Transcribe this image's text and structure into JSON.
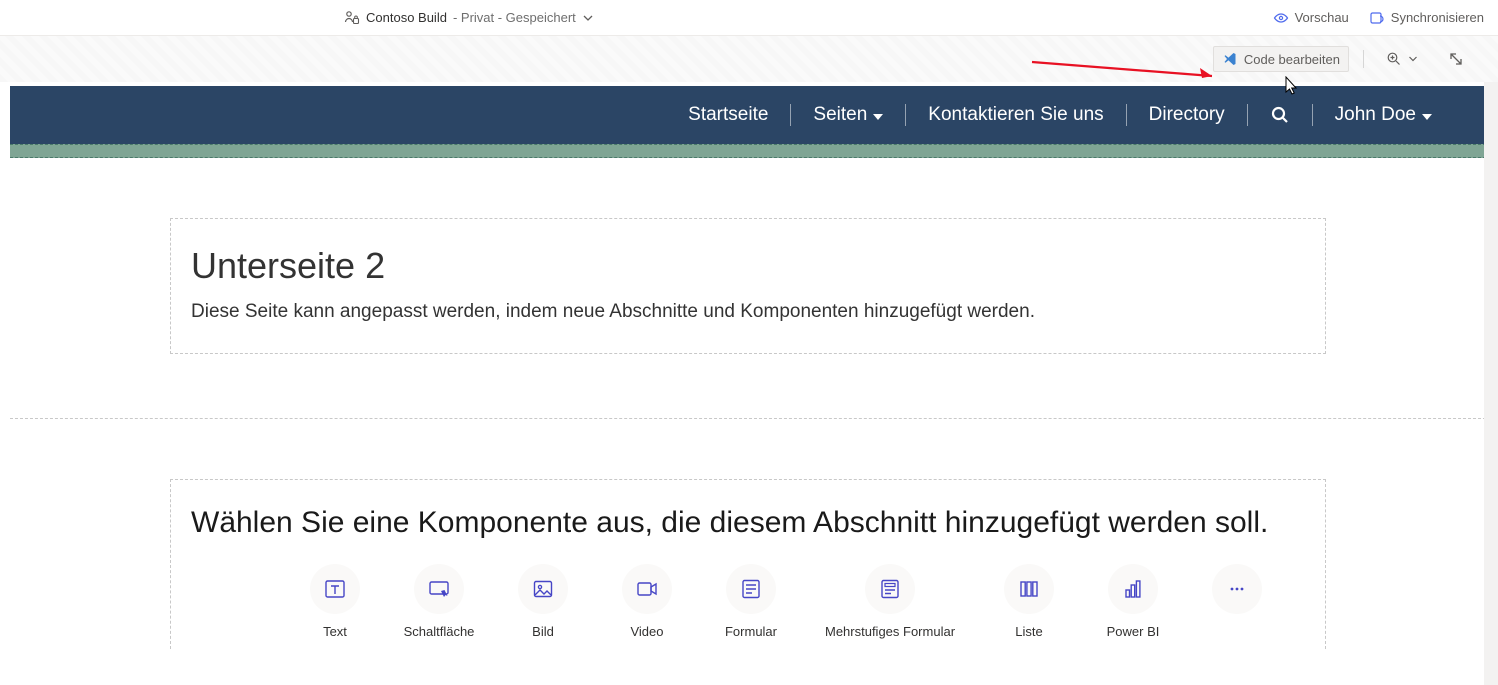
{
  "appbar": {
    "site_name": "Contoso Build",
    "status": " - Privat - Gespeichert",
    "preview_label": "Vorschau",
    "sync_label": "Synchronisieren"
  },
  "toolbar": {
    "code_edit_label": "Code bearbeiten"
  },
  "nav": {
    "home": "Startseite",
    "pages": "Seiten",
    "contact": "Kontaktieren Sie uns",
    "directory": "Directory",
    "user": "John Doe"
  },
  "content": {
    "title": "Unterseite 2",
    "description": "Diese Seite kann angepasst werden, indem neue Abschnitte und Komponenten hinzugefügt werden."
  },
  "component_picker": {
    "prompt": "Wählen Sie eine Komponente aus, die diesem Abschnitt hinzugefügt werden soll.",
    "items": {
      "text": "Text",
      "button": "Schaltfläche",
      "image": "Bild",
      "video": "Video",
      "form": "Formular",
      "multistep_form": "Mehrstufiges Formular",
      "list": "Liste",
      "powerbi": "Power BI"
    }
  }
}
